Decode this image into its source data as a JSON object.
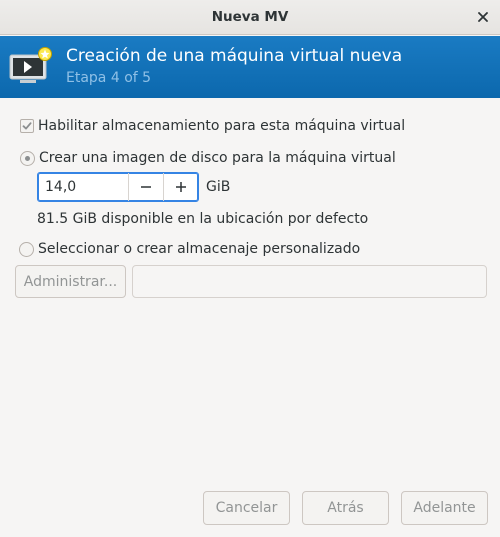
{
  "window": {
    "title": "Nueva MV"
  },
  "header": {
    "title": "Creación de una máquina virtual nueva",
    "subtitle": "Etapa 4 of 5",
    "icon": "vm-new-icon"
  },
  "storage": {
    "enable_label": "Habilitar almacenamiento para esta máquina virtual",
    "enable_checked": true,
    "create_disk_label": "Crear una imagen de disco para la máquina virtual",
    "create_disk_selected": true,
    "size_value": "14,0",
    "size_unit": "GiB",
    "available_text": "81.5 GiB disponible en la ubicación por defecto",
    "custom_label": "Seleccionar o crear almacenaje personalizado",
    "custom_selected": false,
    "manage_label": "Administrar...",
    "path_value": ""
  },
  "buttons": {
    "cancel": "Cancelar",
    "back": "Atrás",
    "forward": "Adelante"
  }
}
